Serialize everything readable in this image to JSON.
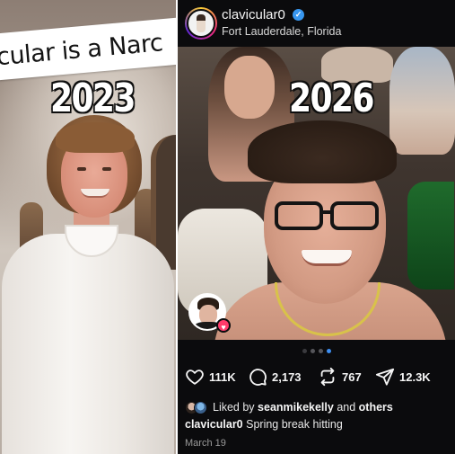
{
  "left_panel": {
    "banner_text": "cular is a Narc",
    "year_label": "2023"
  },
  "right_panel": {
    "year_label": "2026",
    "post": {
      "username": "clavicular0",
      "location": "Fort Lauderdale, Florida",
      "verified": true,
      "carousel": {
        "total_slides": 4,
        "active_slide": 4
      },
      "actions": {
        "likes": "111K",
        "comments": "2,173",
        "reposts": "767",
        "shares": "12.3K"
      },
      "liked_by": {
        "prefix": "Liked by",
        "user": "seanmikekelly",
        "connector": "and",
        "suffix": "others"
      },
      "caption": {
        "username": "clavicular0",
        "text": "Spring break hitting"
      },
      "date": "March 19"
    }
  },
  "colors": {
    "background_dark": "#0b0b0d",
    "verified_blue": "#3897f0",
    "active_dot": "#3e8ff2",
    "heart_badge": "#ff3b6b"
  },
  "icons": [
    "verified-icon",
    "heart-icon",
    "comment-icon",
    "repost-icon",
    "share-icon"
  ]
}
